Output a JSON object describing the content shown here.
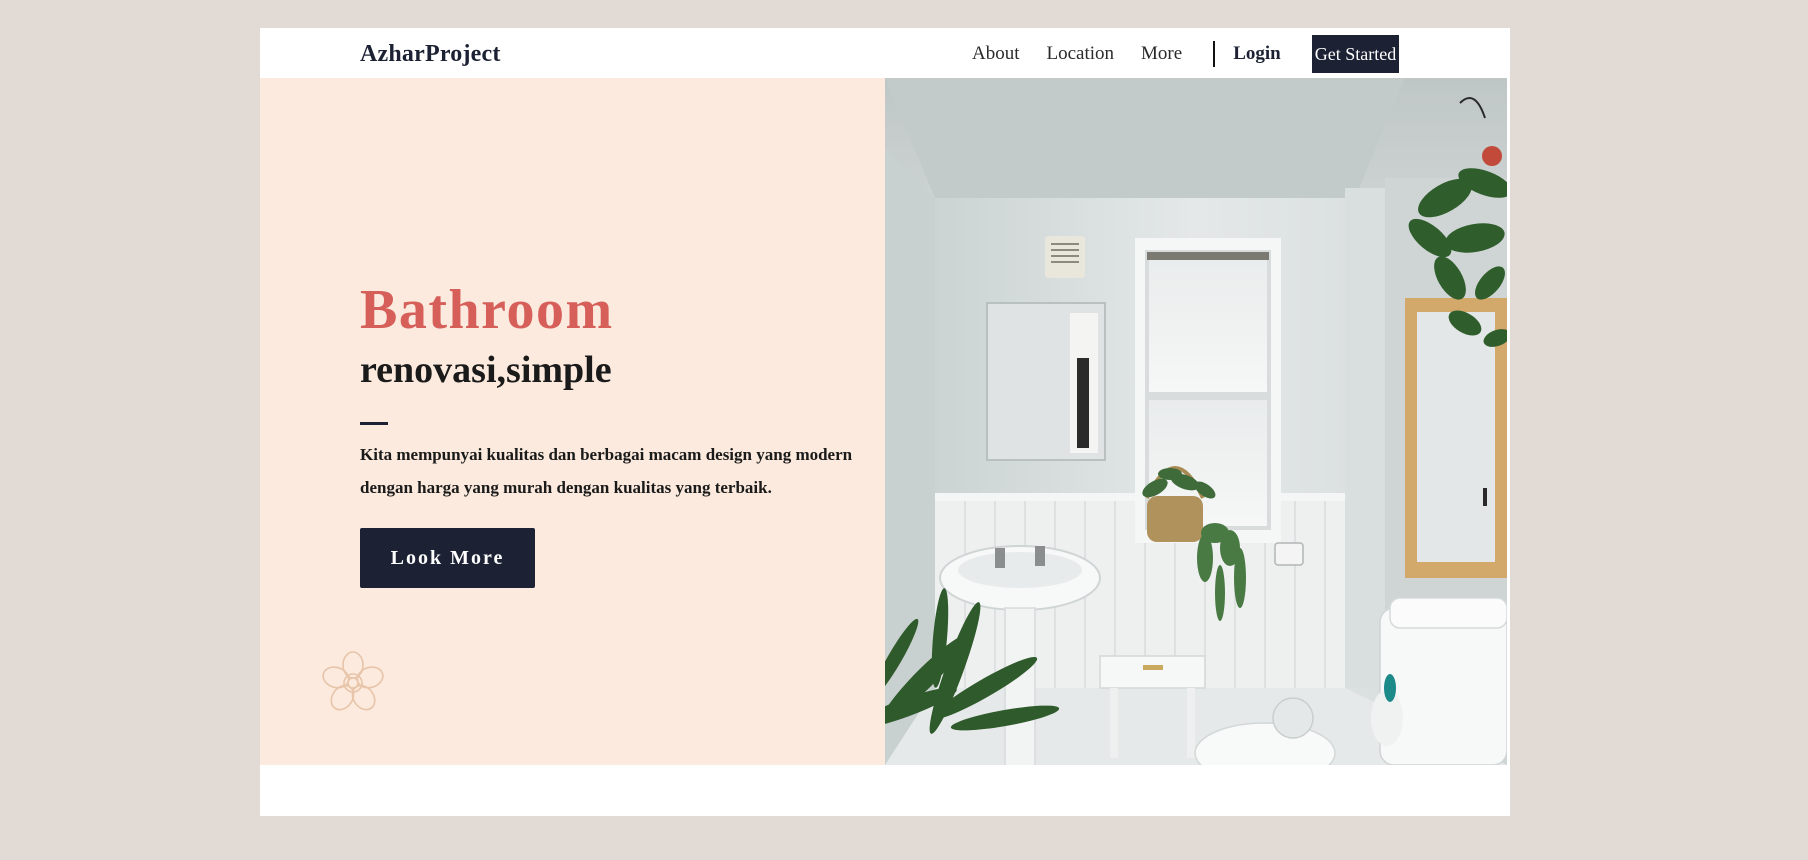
{
  "brand": "AzharProject",
  "nav": {
    "links": [
      "About",
      "Location",
      "More"
    ],
    "login": "Login",
    "cta": "Get Started"
  },
  "hero": {
    "title": "Bathroom",
    "subtitle": "renovasi,simple",
    "description": "Kita mempunyai kualitas dan berbagai macam design yang modern dengan harga yang murah dengan kualitas yang terbaik.",
    "button": "Look More"
  },
  "colors": {
    "page_bg": "#e2dad5",
    "hero_bg": "#fbeadd",
    "accent": "#d65f5a",
    "dark": "#1c2233"
  },
  "icons": {
    "decoration": "flower-icon"
  }
}
